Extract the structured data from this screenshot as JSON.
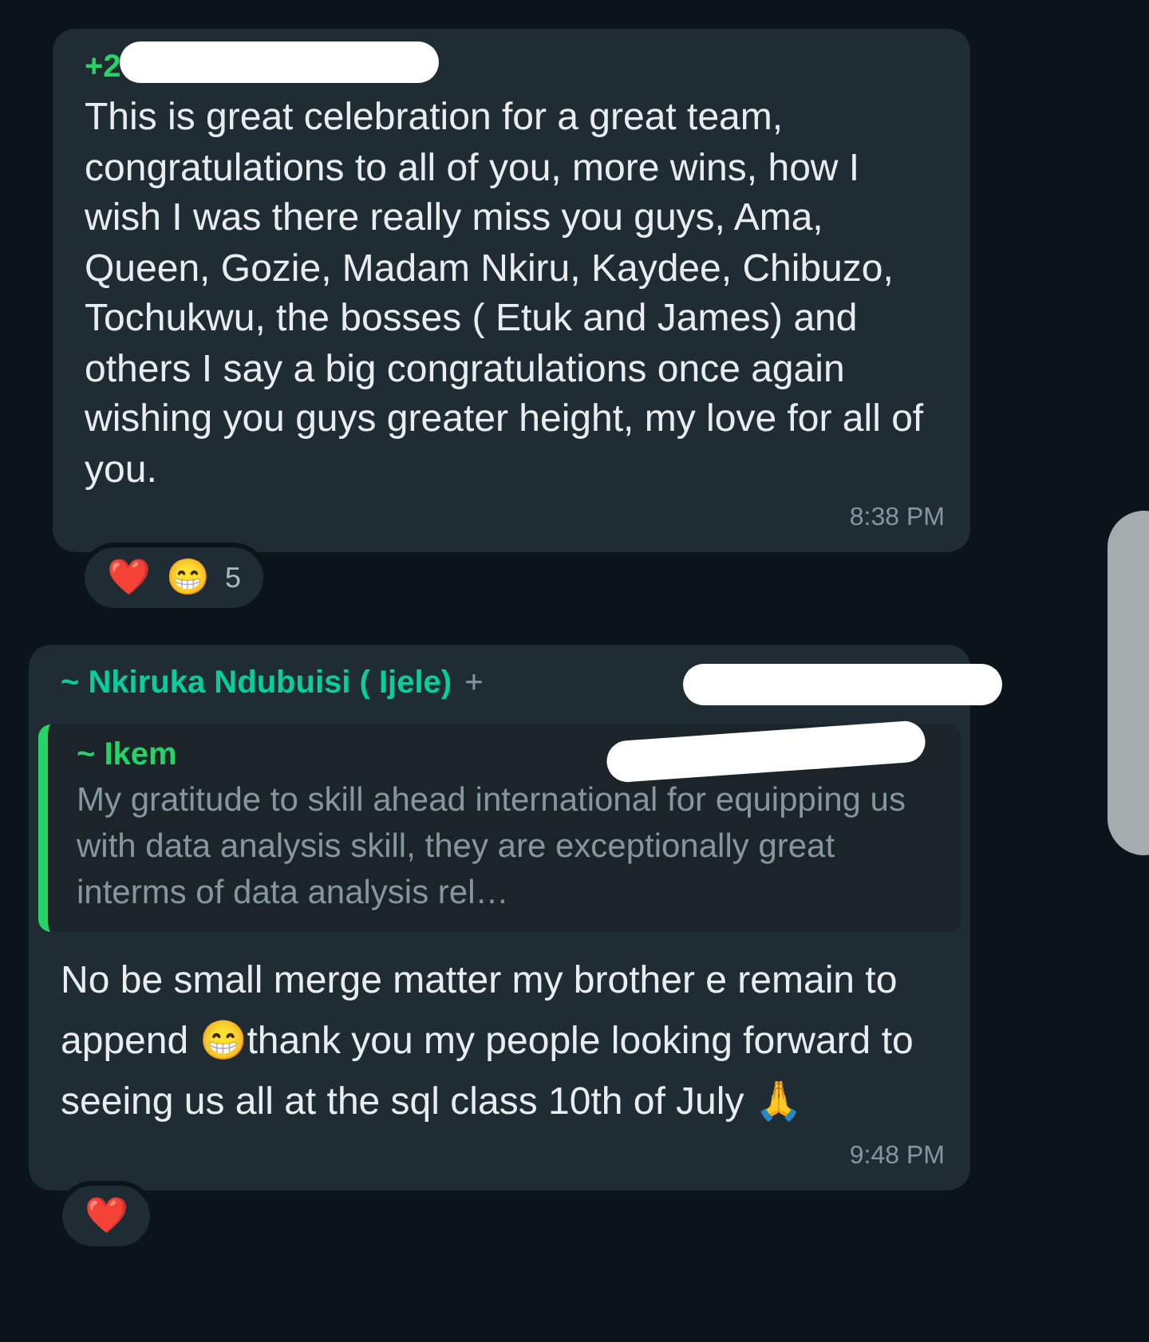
{
  "messages": [
    {
      "kind": "plain",
      "sender": "+2",
      "sender_redacted": true,
      "text": "This is great celebration for a great team, congratulations to all of you, more wins, how I wish I was there really miss you guys, Ama, Queen, Gozie, Madam Nkiru, Kaydee, Chibuzo, Tochukwu, the bosses ( Etuk and James) and others I say a big congratulations once again wishing you guys greater height, my love for all of you.",
      "time": "8:38 PM",
      "reactions": {
        "emojis": [
          "❤️",
          "😁"
        ],
        "count": "5"
      }
    },
    {
      "kind": "reply",
      "sender": "~ Nkiruka Ndubuisi ( Ijele)",
      "phone": "+",
      "sender_redacted": true,
      "quote": {
        "author": "~ Ikem",
        "author_redacted": true,
        "text": "My gratitude to skill ahead international for equipping us with data analysis skill, they are exceptionally great interms of data analysis rel…"
      },
      "text": "No be small merge matter my brother e remain to append 😁thank you my people looking forward to seeing us all at the sql class 10th of July 🙏",
      "time": "9:48 PM",
      "reactions": {
        "emojis": [
          "❤️"
        ]
      }
    }
  ]
}
